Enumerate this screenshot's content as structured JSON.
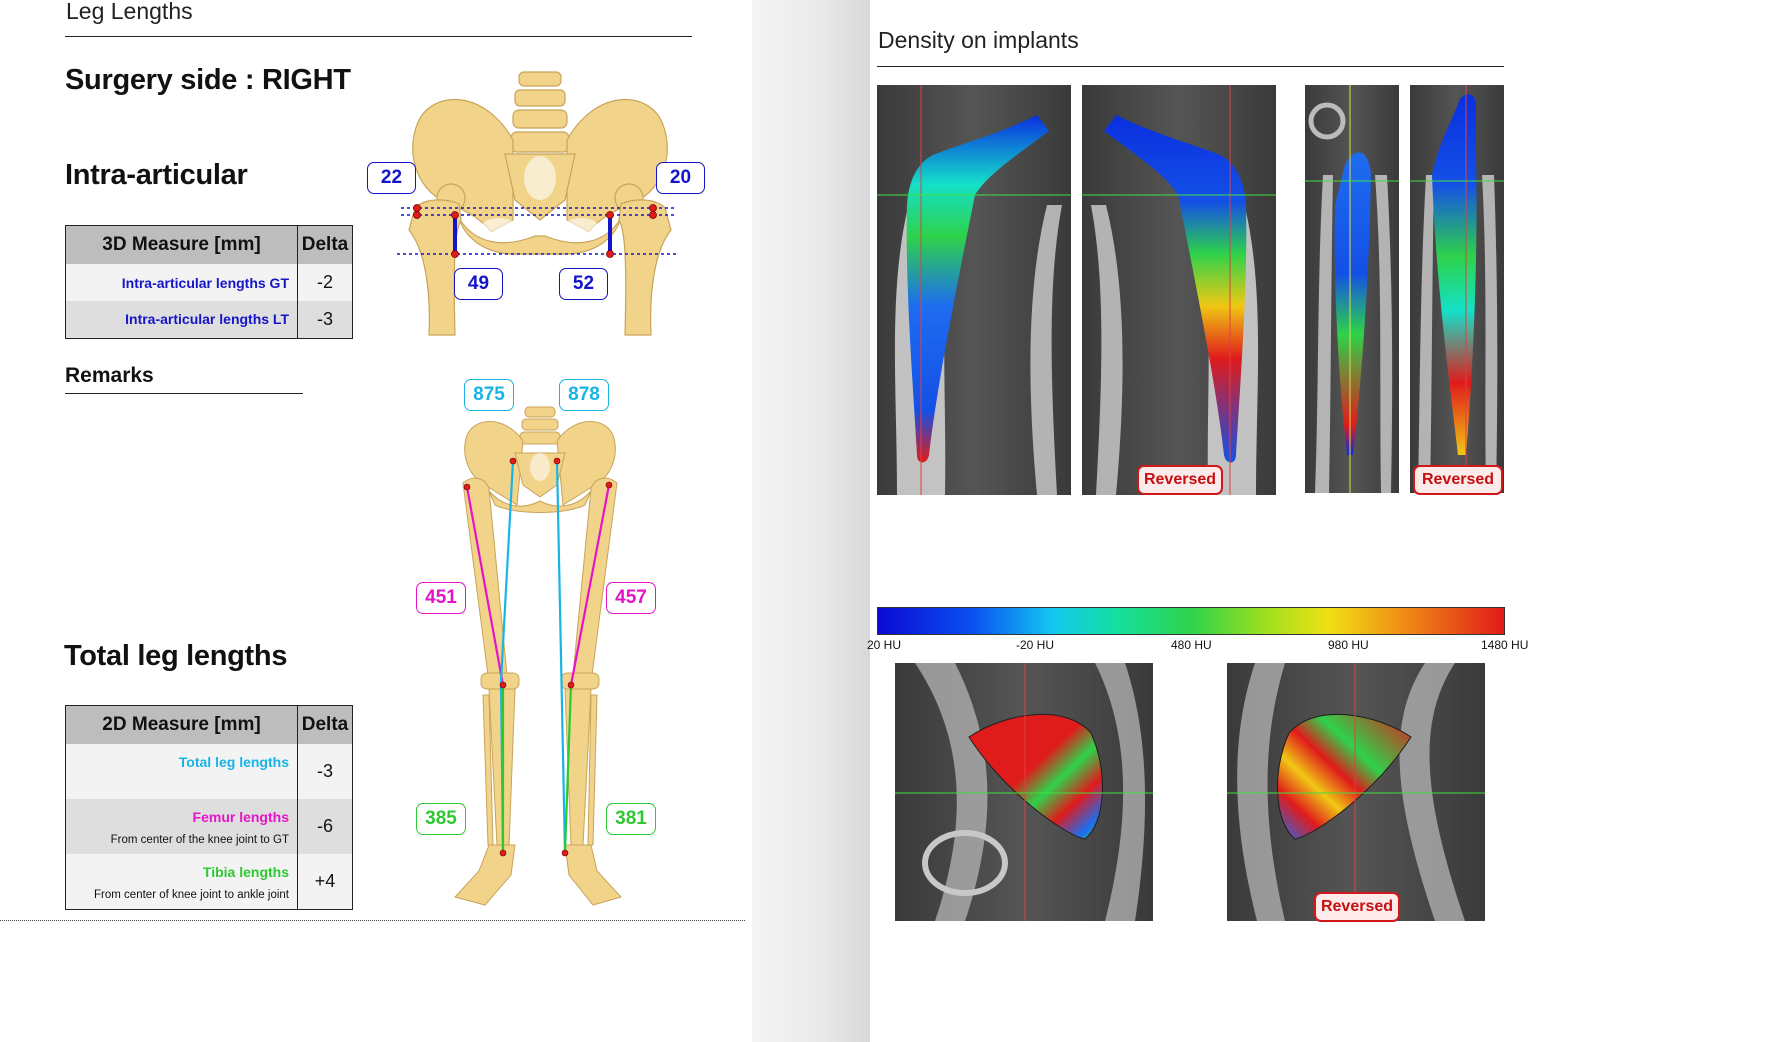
{
  "left": {
    "section_title": "Leg Lengths",
    "surgery_side": "Surgery side : RIGHT",
    "intra_articular": {
      "heading": "Intra-articular",
      "col_measure": "3D Measure [mm]",
      "col_delta": "Delta",
      "rows": [
        {
          "label": "Intra-articular lengths GT",
          "delta": "-2"
        },
        {
          "label": "Intra-articular lengths LT",
          "delta": "-3"
        }
      ],
      "badges": {
        "gt_right": "22",
        "gt_left": "20",
        "lt_right": "49",
        "lt_left": "52"
      }
    },
    "remarks": {
      "heading": "Remarks"
    },
    "total": {
      "heading": "Total leg lengths",
      "col_measure": "2D Measure [mm]",
      "col_delta": "Delta",
      "rows": [
        {
          "label": "Total leg lengths",
          "sub": "",
          "delta": "-3"
        },
        {
          "label": "Femur lengths",
          "sub": "From center of the knee joint to GT",
          "delta": "-6"
        },
        {
          "label": "Tibia lengths",
          "sub": "From center of knee joint to ankle joint",
          "delta": "+4"
        }
      ],
      "badges": {
        "total_right": "875",
        "total_left": "878",
        "femur_right": "451",
        "femur_left": "457",
        "tibia_right": "385",
        "tibia_left": "381"
      }
    }
  },
  "right": {
    "section_title": "Density on implants",
    "reversed_label": "Reversed",
    "colorbar_labels": [
      "20 HU",
      "-20 HU",
      "480 HU",
      "980 HU",
      "1480 HU"
    ]
  },
  "colors": {
    "intra_blue": "#1414c8",
    "total_cyan": "#18b4e6",
    "femur_magenta": "#e614c8",
    "tibia_green": "#2ec832",
    "reversed_red": "#d21818",
    "bone": "#f2d38a"
  }
}
